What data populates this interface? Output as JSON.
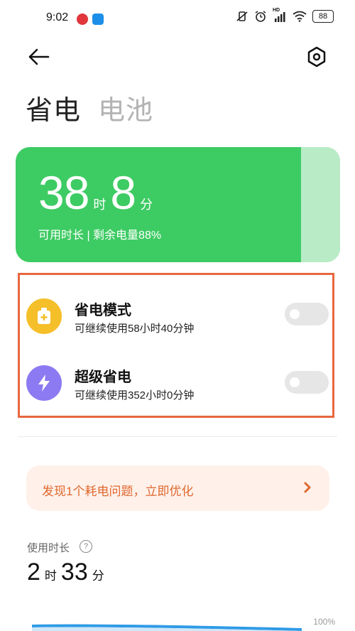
{
  "status_bar": {
    "time": "9:02",
    "battery_level": "88",
    "network_tag": "HD"
  },
  "nav": {
    "back_icon": "arrow-left-icon",
    "settings_icon": "hexagon-settings-icon"
  },
  "tabs": [
    {
      "label": "省电",
      "active": true
    },
    {
      "label": "电池",
      "active": false
    }
  ],
  "battery_card": {
    "hours": "38",
    "hours_unit": "时",
    "minutes": "8",
    "minutes_unit": "分",
    "subtitle": "可用时长 | 剩余电量88%",
    "remaining_percent": 88,
    "color": "#3dcb63"
  },
  "modes": [
    {
      "title": "省电模式",
      "desc": "可继续使用58小时40分钟",
      "icon": "battery-plus-icon",
      "icon_color": "#f5bf2a",
      "enabled": false
    },
    {
      "title": "超级省电",
      "desc": "可继续使用352小时0分钟",
      "icon": "lightning-icon",
      "icon_color": "#8c7af2",
      "enabled": false
    }
  ],
  "alert": {
    "text": "发现1个耗电问题，立即优化"
  },
  "usage": {
    "label": "使用时长",
    "hours": "2",
    "hours_unit": "时",
    "minutes": "33",
    "minutes_unit": "分"
  },
  "chart": {
    "max_label": "100%"
  },
  "colors": {
    "highlight_border": "#e8673f",
    "alert_text": "#e0672e"
  }
}
